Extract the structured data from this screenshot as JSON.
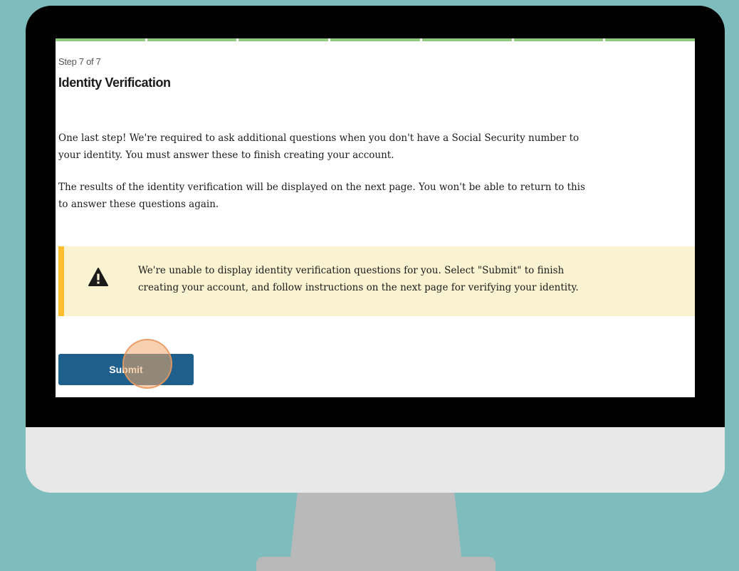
{
  "step": {
    "label": "Step 7 of 7",
    "segments": 7
  },
  "page": {
    "title": "Identity Verification"
  },
  "intro": {
    "paragraph1_line1": "One last step! We're required to ask additional questions when you don't have a Social Security number to",
    "paragraph1_line2": "your identity. You must answer these to finish creating your account.",
    "paragraph2_line1": "The results of the identity verification will be displayed on the next page. You won't be able to return to this",
    "paragraph2_line2": "to answer these questions again."
  },
  "alert": {
    "icon": "warning-icon",
    "line1": "We're unable to display identity verification questions for you. Select \"Submit\" to finish",
    "line2": "creating your account, and follow instructions on the next page for verifying your identity."
  },
  "actions": {
    "submit_label": "Submit"
  },
  "colors": {
    "background": "#7fbcbd",
    "progress": "#8fca7e",
    "alert_bg": "#faf3d1",
    "alert_border": "#ffbe2e",
    "button": "#1f5f8b"
  }
}
